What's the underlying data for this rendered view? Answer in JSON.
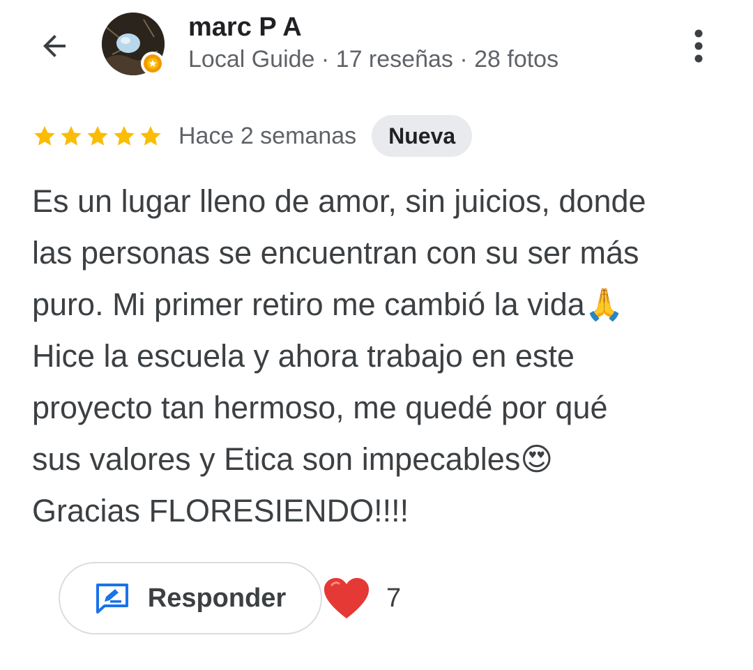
{
  "header": {
    "back_icon": "arrow-left-icon",
    "user_name": "marc P A",
    "user_meta": "Local Guide · 17 reseñas · 28 fotos",
    "avatar_badge_icon": "local-guide-badge-icon",
    "more_icon": "more-vertical-icon"
  },
  "review": {
    "rating": 5,
    "rating_max": 5,
    "star_color": "#fbbc04",
    "date": "Hace 2 semanas",
    "badge": "Nueva",
    "text_lines": [
      "Es un lugar lleno de amor, sin juicios, donde",
      "las personas se encuentran con su ser más",
      "puro. Mi primer retiro me cambió la vida🙏",
      "Hice la escuela y ahora trabajo en este",
      "proyecto tan hermoso, me quedé por qué",
      "sus valores y Etica son impecables😍",
      "Gracias FLORESIENDO!!!!"
    ]
  },
  "actions": {
    "reply_icon": "reply-edit-icon",
    "reply_label": "Responder",
    "reaction_icon": "red-heart-icon",
    "reaction_count": "7"
  },
  "colors": {
    "accent_blue": "#1a73e8",
    "heart_red": "#e53935",
    "text_secondary": "#5f6368"
  }
}
